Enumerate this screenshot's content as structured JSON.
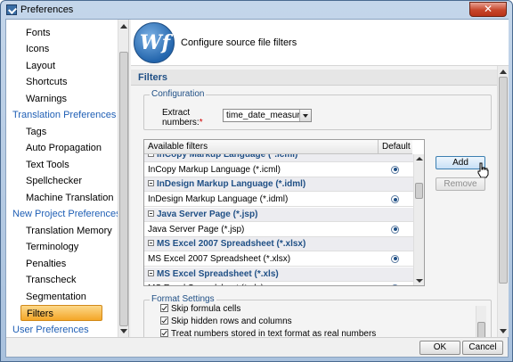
{
  "window": {
    "title": "Preferences",
    "close_glyph": "✕"
  },
  "sidebar": {
    "items": [
      {
        "label": "Fonts",
        "level": "sub",
        "selected": false
      },
      {
        "label": "Icons",
        "level": "sub",
        "selected": false
      },
      {
        "label": "Layout",
        "level": "sub",
        "selected": false
      },
      {
        "label": "Shortcuts",
        "level": "sub",
        "selected": false
      },
      {
        "label": "Warnings",
        "level": "sub",
        "selected": false
      },
      {
        "label": "Translation Preferences",
        "level": "head",
        "selected": false
      },
      {
        "label": "Tags",
        "level": "sub",
        "selected": false
      },
      {
        "label": "Auto Propagation",
        "level": "sub",
        "selected": false
      },
      {
        "label": "Text Tools",
        "level": "sub",
        "selected": false
      },
      {
        "label": "Spellchecker",
        "level": "sub",
        "selected": false
      },
      {
        "label": "Machine Translation",
        "level": "sub",
        "selected": false
      },
      {
        "label": "New Project Preferences",
        "level": "head",
        "selected": false
      },
      {
        "label": "Translation Memory",
        "level": "sub",
        "selected": false
      },
      {
        "label": "Terminology",
        "level": "sub",
        "selected": false
      },
      {
        "label": "Penalties",
        "level": "sub",
        "selected": false
      },
      {
        "label": "Transcheck",
        "level": "sub",
        "selected": false
      },
      {
        "label": "Segmentation",
        "level": "sub",
        "selected": false
      },
      {
        "label": "Filters",
        "level": "sub",
        "selected": true
      },
      {
        "label": "User Preferences",
        "level": "head",
        "selected": false
      }
    ]
  },
  "banner": {
    "logo_text": "Wf",
    "title": "Configure source file filters"
  },
  "section": {
    "title": "Filters"
  },
  "configuration": {
    "legend": "Configuration",
    "extract_label_line1": "Extract",
    "extract_label_line2": "numbers:",
    "required_mark": "*",
    "extract_value": "time_date_measure"
  },
  "filters_table": {
    "columns": [
      "Available filters",
      "Default"
    ],
    "rows": [
      {
        "type": "group",
        "label": "InCopy Markup Language (*.icml)",
        "partial": true
      },
      {
        "type": "item",
        "label": "InCopy Markup Language (*.icml)",
        "default": true
      },
      {
        "type": "group",
        "label": "InDesign Markup Language (*.idml)"
      },
      {
        "type": "item",
        "label": "InDesign Markup Language (*.idml)",
        "default": true
      },
      {
        "type": "group",
        "label": "Java Server Page (*.jsp)"
      },
      {
        "type": "item",
        "label": "Java Server Page (*.jsp)",
        "default": true
      },
      {
        "type": "group",
        "label": "MS Excel 2007 Spreadsheet (*.xlsx)"
      },
      {
        "type": "item",
        "label": "MS Excel 2007 Spreadsheet (*.xlsx)",
        "default": true
      },
      {
        "type": "group",
        "label": "MS Excel Spreadsheet (*.xls)"
      },
      {
        "type": "item",
        "label": "MS Excel Spreadsheet (*.xls)",
        "default": true
      }
    ]
  },
  "buttons": {
    "add": "Add",
    "remove": "Remove",
    "ok": "OK",
    "cancel": "Cancel"
  },
  "format_settings": {
    "legend": "Format Settings",
    "options": [
      {
        "label": "Skip formula cells",
        "checked": true
      },
      {
        "label": "Skip hidden rows and columns",
        "checked": true
      },
      {
        "label": "Treat numbers stored in text format as real numbers",
        "checked": true
      }
    ]
  }
}
